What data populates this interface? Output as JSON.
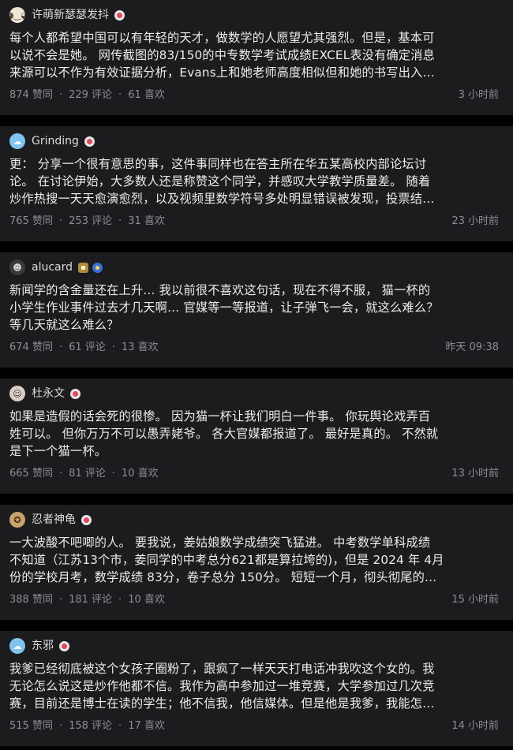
{
  "posts": [
    {
      "author": "许萌新瑟瑟发抖",
      "avatar": {
        "glyph": "◕‿◕",
        "bg": "#f0e6d6",
        "fg": "#5a4a3a"
      },
      "badges": [
        "red"
      ],
      "lines": [
        "每个人都希望中国可以有年轻的天才，做数学的人愿望尤其强烈。但是，基本可",
        "以说不会是她。 网传截图的83/150的中专数学考试成绩EXCEL表没有确定消息",
        "来源可以不作为有效证据分析，Evans上和她老师高度相似但和她的书写出入…"
      ],
      "likes": "874 赞同",
      "comments": "229 评论",
      "favs": "61 喜欢",
      "time": "3 小时前"
    },
    {
      "author": "Grinding",
      "avatar": {
        "glyph": "☁",
        "bg": "#7fc4ee",
        "fg": "#ffffff"
      },
      "badges": [
        "red"
      ],
      "lines": [
        "更： 分享一个很有意思的事，这件事同样也在答主所在华五某高校内部论坛讨",
        "论。 在讨论伊始，大多数人还是称赞这个同学，并感叹大学教学质量差。 随着",
        "炒作热搜一天天愈演愈烈，以及视频里数学符号多处明显错误被发现，投票结…"
      ],
      "likes": "765 赞同",
      "comments": "253 评论",
      "favs": "31 喜欢",
      "time": "23 小时前"
    },
    {
      "author": "alucard",
      "avatar": {
        "glyph": "☻",
        "bg": "#3a3a3a",
        "fg": "#d8d8d8"
      },
      "badges": [
        "gold",
        "blue"
      ],
      "lines": [
        "新闻学的含金量还在上升… 我以前很不喜欢这句话，现在不得不服， 猫一杯的",
        "小学生作业事件过去才几天啊… 官媒等一等报道，让子弹飞一会，就这么难么？",
        "等几天就这么难么？"
      ],
      "likes": "674 赞同",
      "comments": "61 评论",
      "favs": "13 喜欢",
      "time": "昨天 09:38"
    },
    {
      "author": "杜永文",
      "avatar": {
        "glyph": "☺",
        "bg": "#d9cfc8",
        "fg": "#3d2f28"
      },
      "badges": [
        "red"
      ],
      "lines": [
        "如果是造假的话会死的很惨。 因为猫一杯让我们明白一件事。 你玩舆论戏弄百",
        "姓可以。 但你万万不可以愚弄姥爷。 各大官媒都报道了。 最好是真的。 不然就",
        "是下一个猫一杯。"
      ],
      "likes": "665 赞同",
      "comments": "81 评论",
      "favs": "10 喜欢",
      "time": "13 小时前"
    },
    {
      "author": "忍者神龟",
      "avatar": {
        "glyph": "✪",
        "bg": "#c8a46a",
        "fg": "#3b2a12"
      },
      "badges": [
        "red"
      ],
      "lines": [
        "一大波酸不吧唧的人。 要我说，姜姑娘数学成绩突飞猛进。 中考数学单科成绩",
        "不知道（江苏13个市，姜同学的中考总分621都是算拉垮的)，但是 2024 年 4月",
        "份的学校月考，数学成绩 83分，卷子总分 150分。 短短一个月，彻头彻尾的…"
      ],
      "likes": "388 赞同",
      "comments": "181 评论",
      "favs": "10 喜欢",
      "time": "15 小时前"
    },
    {
      "author": "东邪",
      "avatar": {
        "glyph": "☁",
        "bg": "#7fc4ee",
        "fg": "#ffffff"
      },
      "badges": [
        "red"
      ],
      "lines": [
        "我爹已经彻底被这个女孩子圈粉了，跟疯了一样天天打电话冲我吹这个女的。我",
        "无论怎么说这是炒作他都不信。我作为高中参加过一堆竞赛，大学参加过几次竞",
        "赛，目前还是博士在读的学生；他不信我，他信媒体。但是他是我爹，我能怎…"
      ],
      "likes": "515 赞同",
      "comments": "158 评论",
      "favs": "17 喜欢",
      "time": "14 小时前"
    }
  ]
}
